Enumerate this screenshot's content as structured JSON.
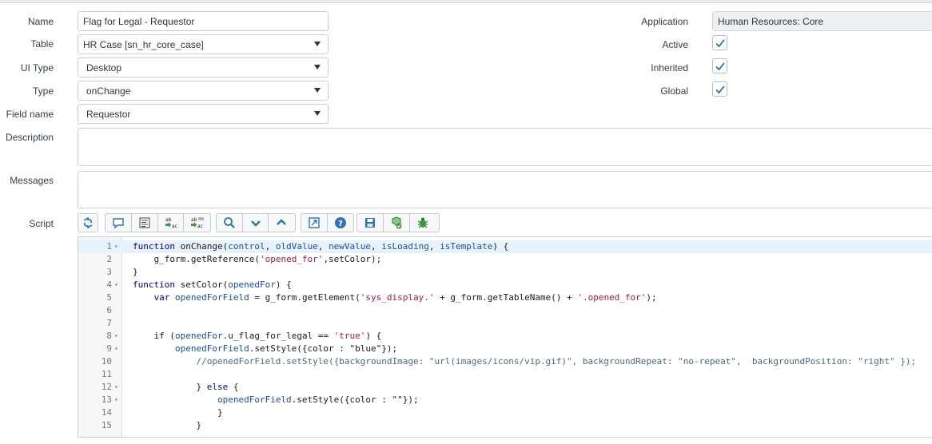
{
  "form": {
    "name": {
      "label": "Name",
      "value": "Flag for Legal - Requestor"
    },
    "table": {
      "label": "Table",
      "value": "HR Case [sn_hr_core_case]"
    },
    "ui_type": {
      "label": "UI Type",
      "value": "Desktop"
    },
    "type": {
      "label": "Type",
      "value": "onChange"
    },
    "field_name": {
      "label": "Field name",
      "value": "Requestor"
    },
    "description": {
      "label": "Description",
      "value": ""
    },
    "messages": {
      "label": "Messages",
      "value": ""
    },
    "script": {
      "label": "Script"
    },
    "application": {
      "label": "Application",
      "value": "Human Resources: Core"
    },
    "active": {
      "label": "Active",
      "checked": true
    },
    "inherited": {
      "label": "Inherited",
      "checked": true
    },
    "global": {
      "label": "Global",
      "checked": true
    }
  },
  "toolbar": {
    "buttons": [
      "toggle-syntax-icon",
      "comment-icon",
      "format-icon",
      "replace-icon",
      "replace-all-icon",
      "search-icon",
      "chevron-down-icon",
      "chevron-up-icon",
      "fullscreen-icon",
      "help-icon",
      "save-icon",
      "check-script-icon",
      "debug-icon"
    ]
  },
  "editor": {
    "lines": [
      {
        "n": "1",
        "fold": true,
        "code": "function onChange(control, oldValue, newValue, isLoading, isTemplate) {"
      },
      {
        "n": "2",
        "fold": false,
        "code": "    g_form.getReference('opened_for',setColor);"
      },
      {
        "n": "3",
        "fold": false,
        "code": "}"
      },
      {
        "n": "4",
        "fold": true,
        "code": "function setColor(openedFor) {"
      },
      {
        "n": "5",
        "fold": false,
        "code": "    var openedForField = g_form.getElement('sys_display.' + g_form.getTableName() + '.opened_for');"
      },
      {
        "n": "6",
        "fold": false,
        "code": ""
      },
      {
        "n": "7",
        "fold": false,
        "code": ""
      },
      {
        "n": "8",
        "fold": true,
        "code": "    if (openedFor.u_flag_for_legal == 'true') {"
      },
      {
        "n": "9",
        "fold": true,
        "code": "        openedForField.setStyle({color : \"blue\"});"
      },
      {
        "n": "10",
        "fold": false,
        "code": "            //openedForField.setStyle({backgroundImage: \"url(images/icons/vip.gif)\", backgroundRepeat: \"no-repeat\",  backgroundPosition: \"right\" });"
      },
      {
        "n": "11",
        "fold": false,
        "code": ""
      },
      {
        "n": "12",
        "fold": true,
        "code": "            } else {"
      },
      {
        "n": "13",
        "fold": true,
        "code": "                openedForField.setStyle({color : \"\"});"
      },
      {
        "n": "14",
        "fold": false,
        "code": "                }"
      },
      {
        "n": "15",
        "fold": false,
        "code": "            }"
      }
    ]
  },
  "colors": {
    "accent": "#2e72b8",
    "active_line": "#e8f2fb",
    "keyword": "#0000a0",
    "string": "#a11f3b"
  }
}
